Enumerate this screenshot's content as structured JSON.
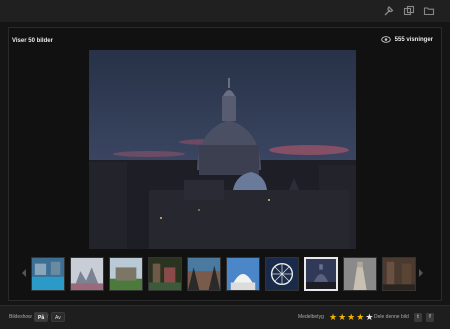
{
  "header": {
    "icons": [
      "tools-icon",
      "copy-icon",
      "folder-icon"
    ]
  },
  "viewer": {
    "count_label": "Viser 50 bilder",
    "views_label": "555 visninger"
  },
  "thumbnails": [
    {
      "name": "thumb-1"
    },
    {
      "name": "thumb-2"
    },
    {
      "name": "thumb-3"
    },
    {
      "name": "thumb-4"
    },
    {
      "name": "thumb-5"
    },
    {
      "name": "thumb-6"
    },
    {
      "name": "thumb-7"
    },
    {
      "name": "thumb-8",
      "active": true
    },
    {
      "name": "thumb-9"
    },
    {
      "name": "thumb-10"
    }
  ],
  "footer": {
    "slideshow_label": "Bildeshow",
    "slideshow_on": "På",
    "slideshow_off": "Av",
    "rating_label": "Medelbetyg",
    "rating": 4,
    "rating_max": 5,
    "share_label": "Dele denne bild",
    "share_twitter": "t",
    "share_facebook": "f"
  },
  "colors": {
    "star": "#f0b400",
    "background": "#151515"
  }
}
